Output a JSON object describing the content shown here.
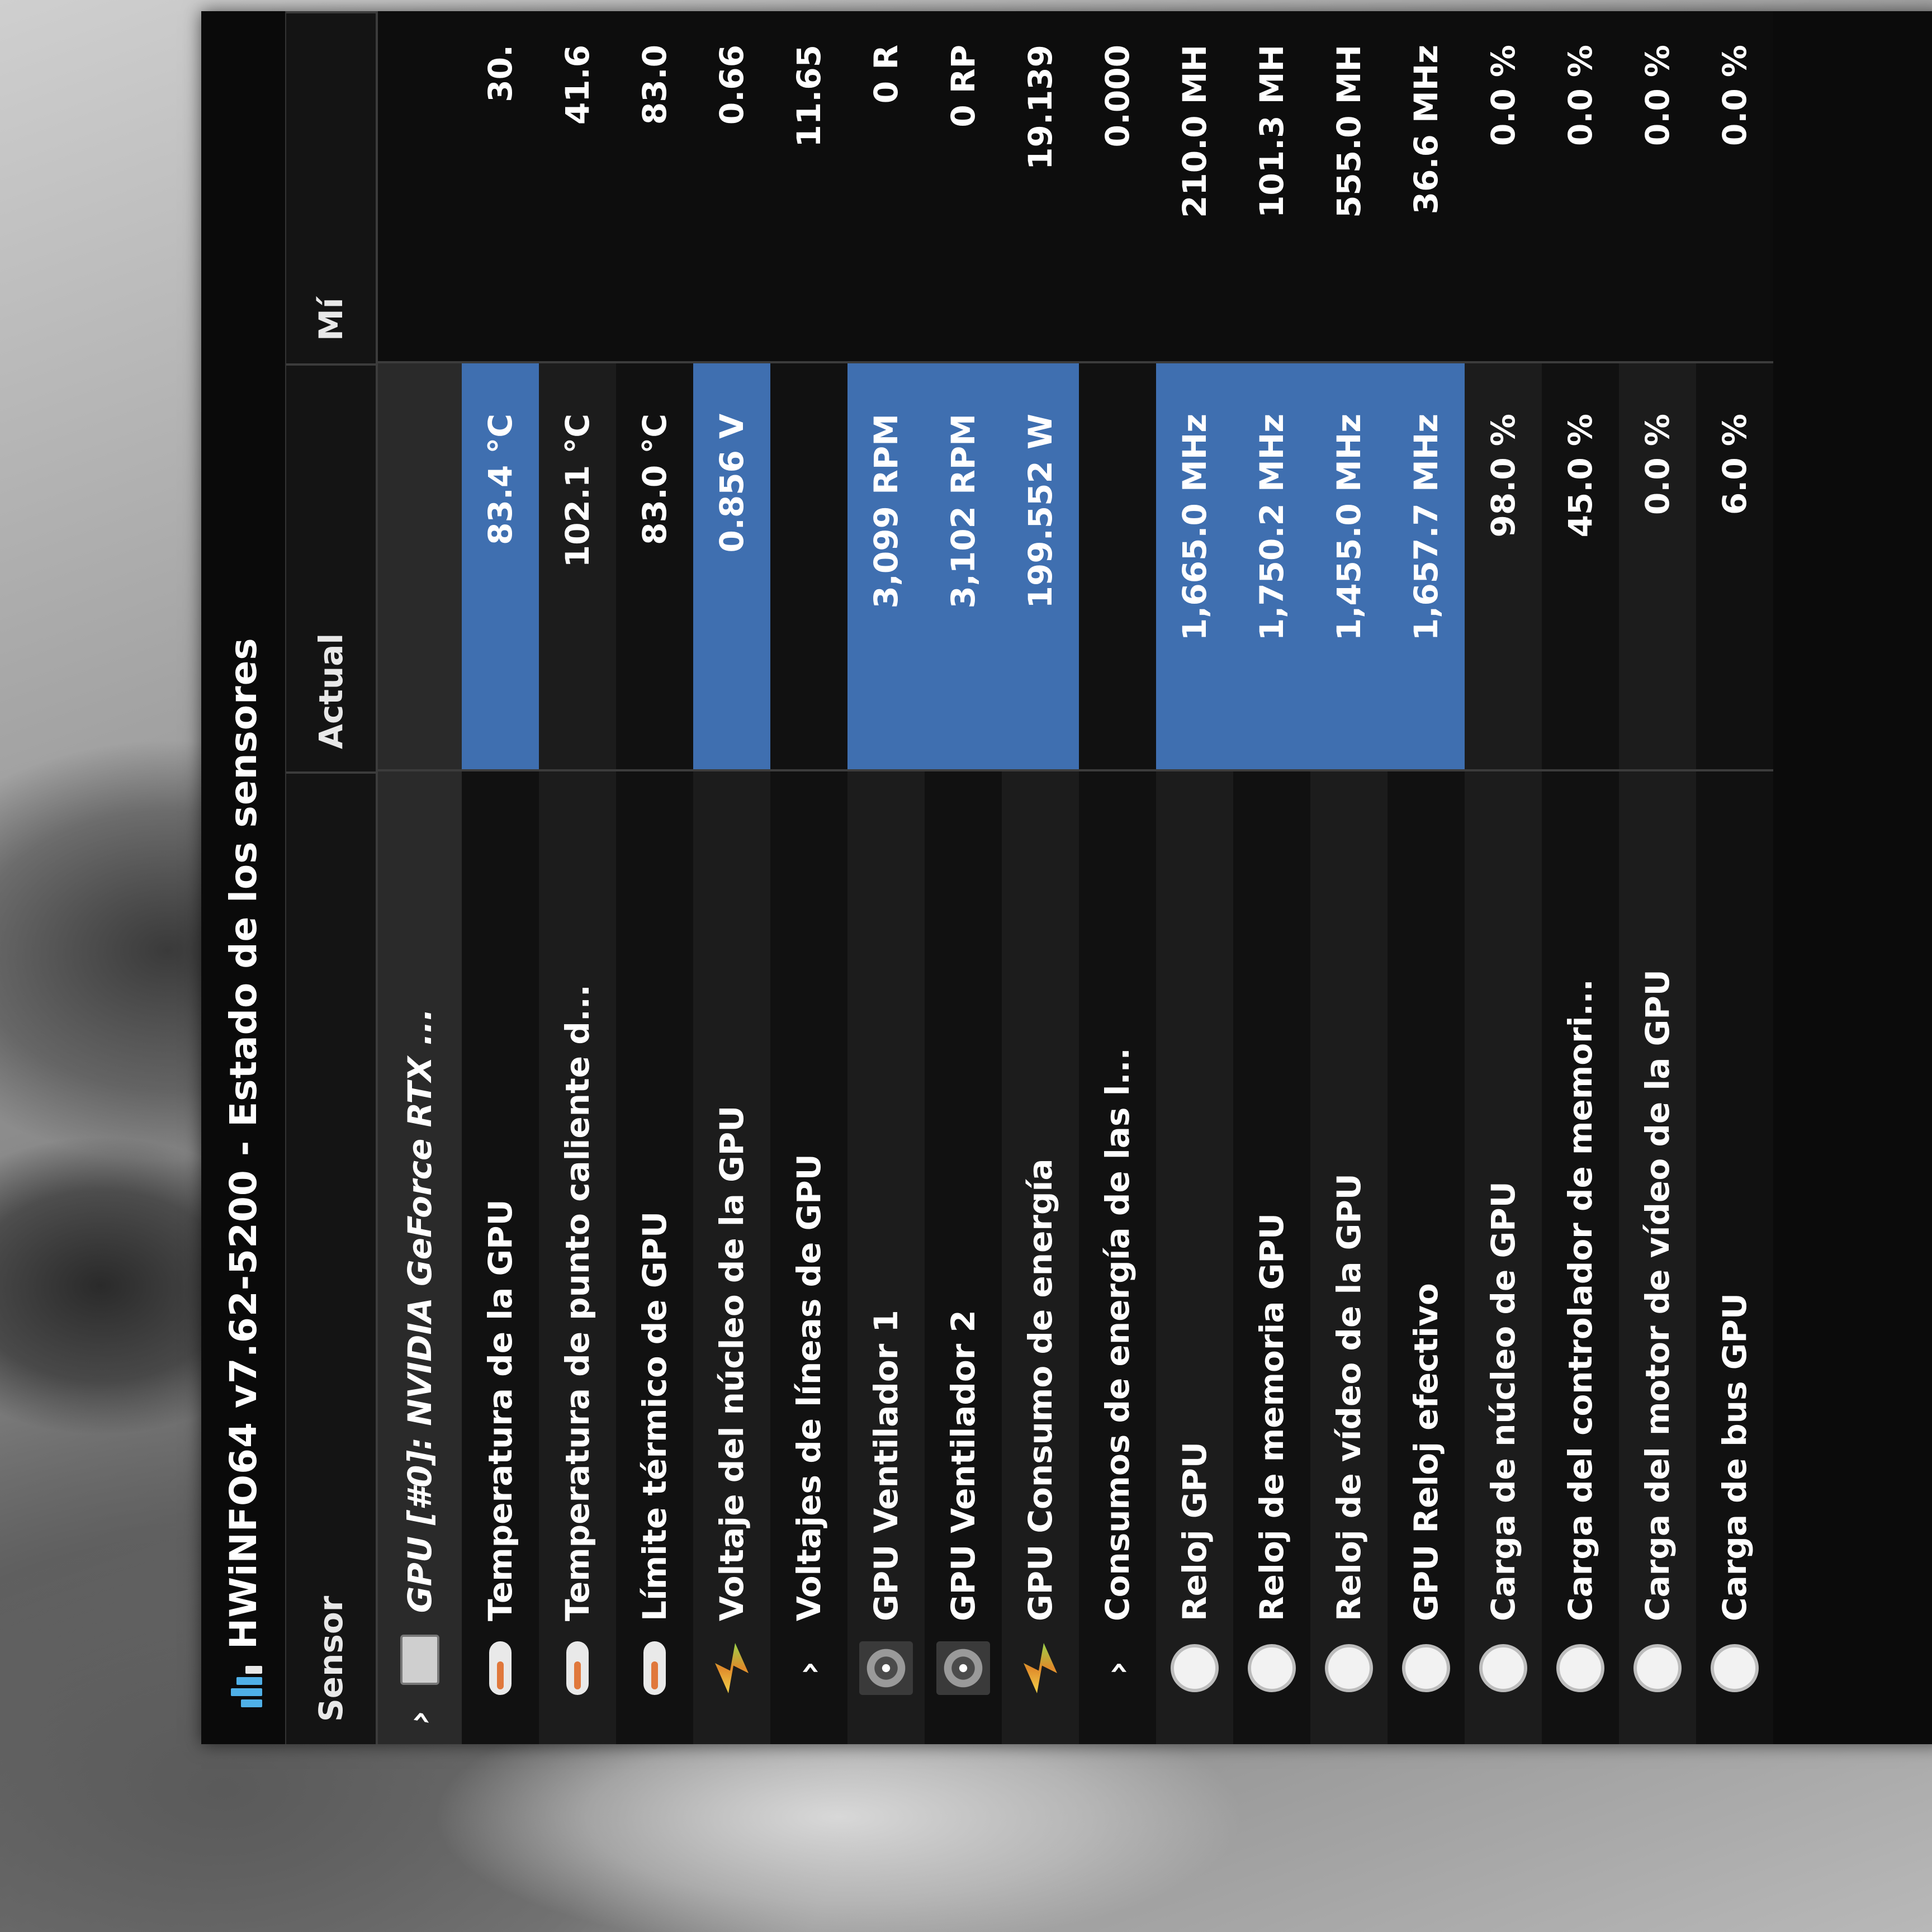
{
  "window": {
    "title": "HWiNFO64 v7.62-5200 - Estado de los sensores"
  },
  "columns": {
    "sensor": "Sensor",
    "actual": "Actual",
    "min": "Mí"
  },
  "rows": [
    {
      "icon": "chip-icon",
      "label": "GPU [#0]: NVIDIA GeForce RTX ...",
      "actual": "",
      "min": ""
    },
    {
      "icon": "thermometer-icon",
      "label": "Temperatura de la GPU",
      "actual": "83.4 °C",
      "min": "30."
    },
    {
      "icon": "thermometer-icon",
      "label": "Temperatura de punto caliente d...",
      "actual": "102.1 °C",
      "min": "41.6"
    },
    {
      "icon": "thermometer-icon",
      "label": "Límite térmico de GPU",
      "actual": "83.0 °C",
      "min": "83.0"
    },
    {
      "icon": "voltage-icon",
      "label": "Voltaje del núcleo de la GPU",
      "actual": "0.856 V",
      "min": "0.66"
    },
    {
      "icon": "chevron-icon",
      "label": "Voltajes de líneas de GPU",
      "actual": "",
      "min": "11.65"
    },
    {
      "icon": "fan-icon",
      "label": "GPU Ventilador 1",
      "actual": "3,099 RPM",
      "min": "0 R"
    },
    {
      "icon": "fan-icon",
      "label": "GPU Ventilador 2",
      "actual": "3,102 RPM",
      "min": "0 RP"
    },
    {
      "icon": "voltage-icon",
      "label": "GPU Consumo de energía",
      "actual": "199.552 W",
      "min": "19.139"
    },
    {
      "icon": "chevron-icon",
      "label": "Consumos de energía de las l...",
      "actual": "",
      "min": "0.000"
    },
    {
      "icon": "clock-icon",
      "label": "Reloj GPU",
      "actual": "1,665.0 MHz",
      "min": "210.0 MH"
    },
    {
      "icon": "clock-icon",
      "label": "Reloj de memoria GPU",
      "actual": "1,750.2 MHz",
      "min": "101.3 MH"
    },
    {
      "icon": "clock-icon",
      "label": "Reloj de vídeo de la GPU",
      "actual": "1,455.0 MHz",
      "min": "555.0 MH"
    },
    {
      "icon": "clock-icon",
      "label": "GPU Reloj efectivo",
      "actual": "1,657.7 MHz",
      "min": "36.6 MHz"
    },
    {
      "icon": "clock-icon",
      "label": "Carga de núcleo de GPU",
      "actual": "98.0 %",
      "min": "0.0 %"
    },
    {
      "icon": "clock-icon",
      "label": "Carga del controlador de memori...",
      "actual": "45.0 %",
      "min": "0.0 %"
    },
    {
      "icon": "clock-icon",
      "label": "Carga del motor de vídeo de la GPU",
      "actual": "0.0 %",
      "min": "0.0 %"
    },
    {
      "icon": "clock-icon",
      "label": "Carga de bus GPU",
      "actual": "6.0 %",
      "min": "0.0 %"
    }
  ],
  "colors": {
    "highlight": "#3f6fb0",
    "background": "#0b0b0b",
    "text": "#ffffff"
  }
}
